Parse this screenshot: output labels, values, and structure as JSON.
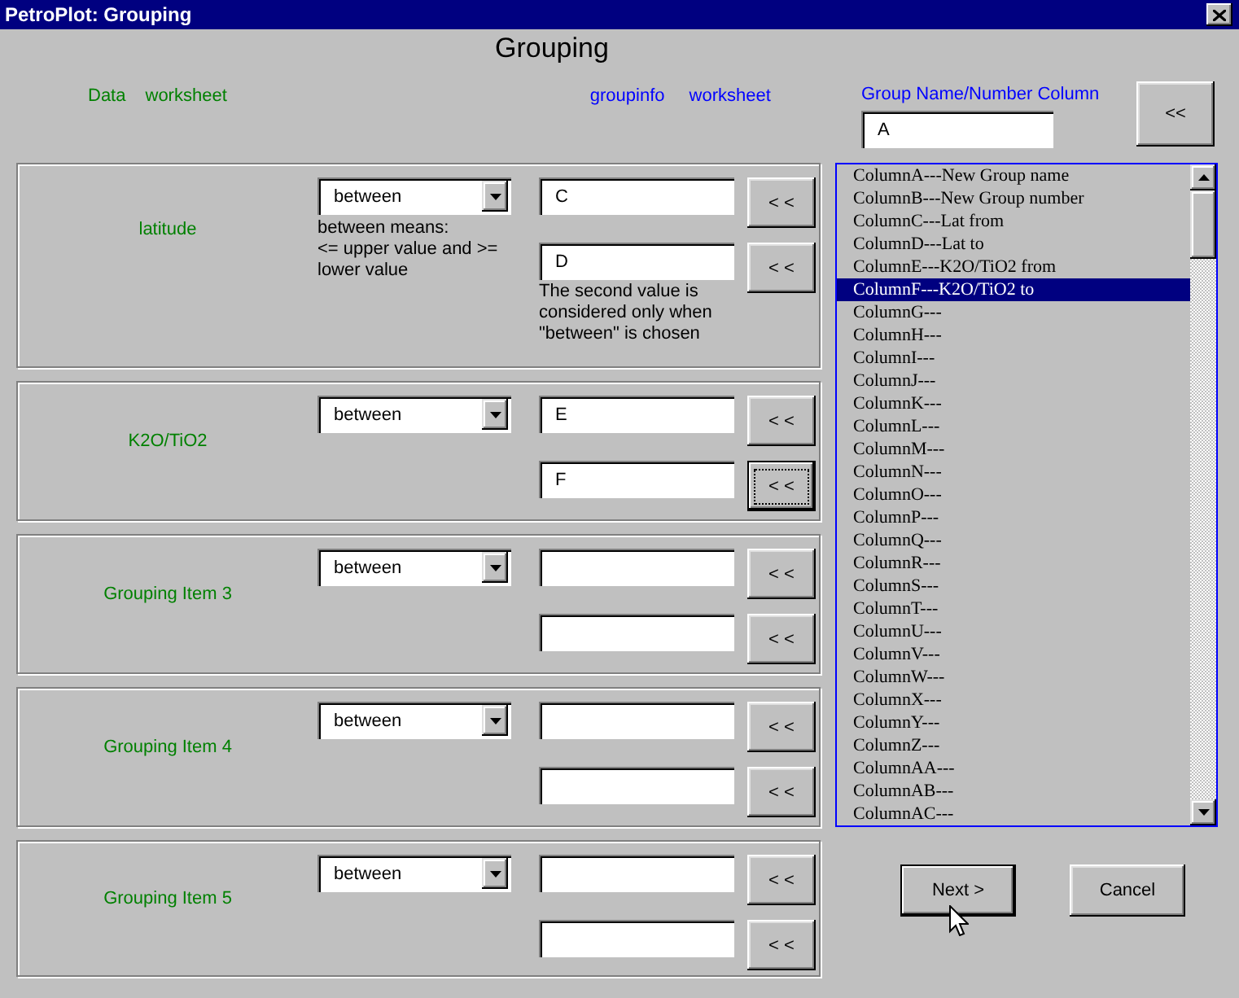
{
  "window": {
    "title": "PetroPlot: Grouping"
  },
  "heading": "Grouping",
  "data_headers": [
    "Data",
    "worksheet"
  ],
  "groupinfo_headers": [
    "groupinfo",
    "worksheet"
  ],
  "groups": [
    {
      "label": "latitude",
      "operator": "between",
      "operator_note": "between means:\n<= upper value and  >=\nlower value",
      "inputs": [
        {
          "value": "C",
          "pick": {
            "label": "< <",
            "focused": false
          }
        },
        {
          "value": "D",
          "pick": {
            "label": "< <",
            "focused": false
          },
          "note": "The second value is\nconsidered only when\n\"between\" is chosen"
        }
      ]
    },
    {
      "label": "K2O/TiO2",
      "operator": "between",
      "inputs": [
        {
          "value": "E",
          "pick": {
            "label": "< <",
            "focused": false
          }
        },
        {
          "value": "F",
          "pick": {
            "label": "< <",
            "focused": true
          }
        }
      ]
    },
    {
      "label": "Grouping Item 3",
      "operator": "between",
      "inputs": [
        {
          "pick": {
            "label": "< <",
            "focused": false
          }
        },
        {
          "pick": {
            "label": "< <",
            "focused": false
          }
        }
      ]
    },
    {
      "label": "Grouping Item 4",
      "operator": "between",
      "inputs": [
        {
          "pick": {
            "label": "< <",
            "focused": false
          }
        },
        {
          "pick": {
            "label": "< <",
            "focused": false
          }
        }
      ]
    },
    {
      "label": "Grouping Item 5",
      "operator": "between",
      "inputs": [
        {
          "pick": {
            "label": "< <",
            "focused": false
          }
        },
        {
          "pick": {
            "label": "< <",
            "focused": false
          }
        }
      ]
    }
  ],
  "group_column": {
    "label": "Group Name/Number Column",
    "value": "A",
    "pick_label": "<<"
  },
  "columns_list": [
    {
      "text": "ColumnA---New Group name",
      "selected": false
    },
    {
      "text": "ColumnB---New Group number",
      "selected": false
    },
    {
      "text": "ColumnC---Lat from",
      "selected": false
    },
    {
      "text": "ColumnD---Lat to",
      "selected": false
    },
    {
      "text": "ColumnE---K2O/TiO2 from",
      "selected": false
    },
    {
      "text": "ColumnF---K2O/TiO2 to",
      "selected": true
    },
    {
      "text": "ColumnG---",
      "selected": false
    },
    {
      "text": "ColumnH---",
      "selected": false
    },
    {
      "text": "ColumnI---",
      "selected": false
    },
    {
      "text": "ColumnJ---",
      "selected": false
    },
    {
      "text": "ColumnK---",
      "selected": false
    },
    {
      "text": "ColumnL---",
      "selected": false
    },
    {
      "text": "ColumnM---",
      "selected": false
    },
    {
      "text": "ColumnN---",
      "selected": false
    },
    {
      "text": "ColumnO---",
      "selected": false
    },
    {
      "text": "ColumnP---",
      "selected": false
    },
    {
      "text": "ColumnQ---",
      "selected": false
    },
    {
      "text": "ColumnR---",
      "selected": false
    },
    {
      "text": "ColumnS---",
      "selected": false
    },
    {
      "text": "ColumnT---",
      "selected": false
    },
    {
      "text": "ColumnU---",
      "selected": false
    },
    {
      "text": "ColumnV---",
      "selected": false
    },
    {
      "text": "ColumnW---",
      "selected": false
    },
    {
      "text": "ColumnX---",
      "selected": false
    },
    {
      "text": "ColumnY---",
      "selected": false
    },
    {
      "text": "ColumnZ---",
      "selected": false
    },
    {
      "text": "ColumnAA---",
      "selected": false
    },
    {
      "text": "ColumnAB---",
      "selected": false
    },
    {
      "text": "ColumnAC---",
      "selected": false
    }
  ],
  "buttons": [
    {
      "label": "Next >",
      "default": true
    },
    {
      "label": "Cancel",
      "default": false
    }
  ]
}
